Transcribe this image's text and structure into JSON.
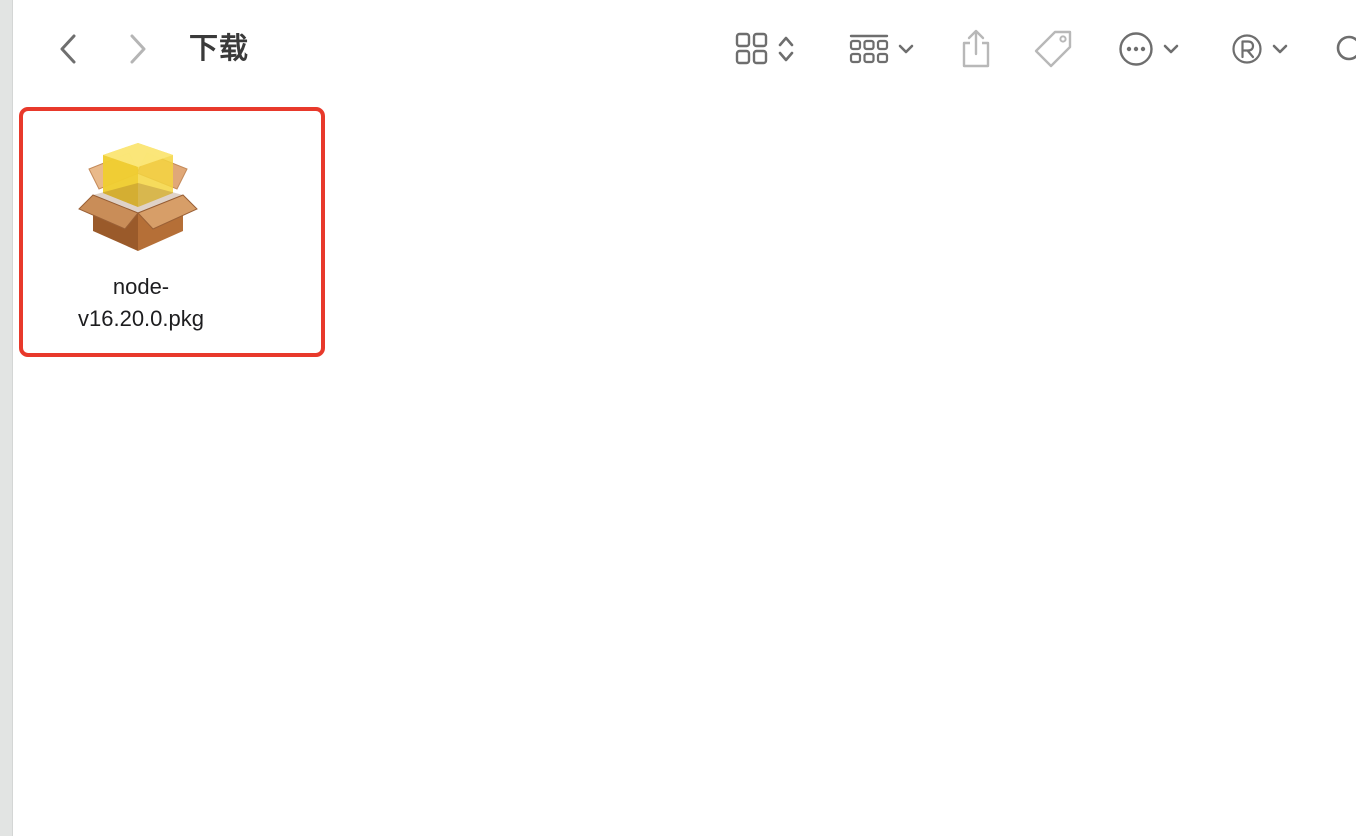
{
  "window": {
    "title": "下载"
  },
  "toolbar": {
    "items": [
      {
        "icon": "icon-grid-icon",
        "has_stepper": true
      },
      {
        "icon": "group-icon",
        "has_chevron": true
      },
      {
        "icon": "share-icon"
      },
      {
        "icon": "tag-icon"
      },
      {
        "icon": "more-icon",
        "has_chevron": true
      },
      {
        "icon": "registered-icon",
        "has_chevron": true
      },
      {
        "icon": "search-icon"
      }
    ]
  },
  "files": [
    {
      "name_line1": "node-",
      "name_line2": "v16.20.0.pkg",
      "icon": "package-icon",
      "selected_highlight_color": "#e8392b"
    }
  ]
}
